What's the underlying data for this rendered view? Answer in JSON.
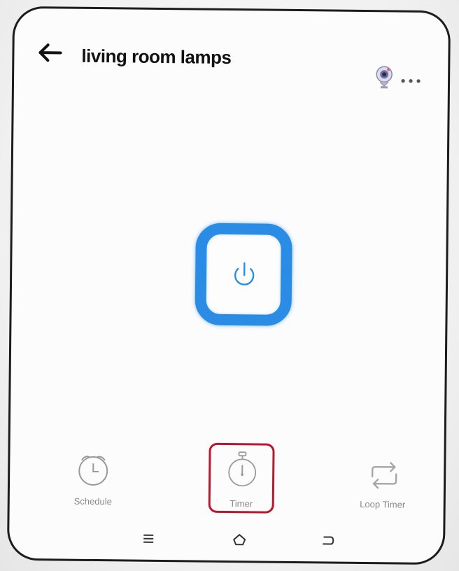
{
  "header": {
    "title": "living room lamps",
    "back_icon": "arrow-left-icon",
    "device_icon": "camera-icon",
    "more_icon": "more-horizontal-icon"
  },
  "power": {
    "icon": "power-icon",
    "accent_color": "#2b8ce6"
  },
  "actions": {
    "schedule_label": "Schedule",
    "timer_label": "Timer",
    "loop_timer_label": "Loop Timer",
    "highlight_color": "#c0142c"
  },
  "system_nav": {
    "menu_icon": "menu-icon",
    "home_icon": "home-icon",
    "back_icon": "back-icon"
  }
}
